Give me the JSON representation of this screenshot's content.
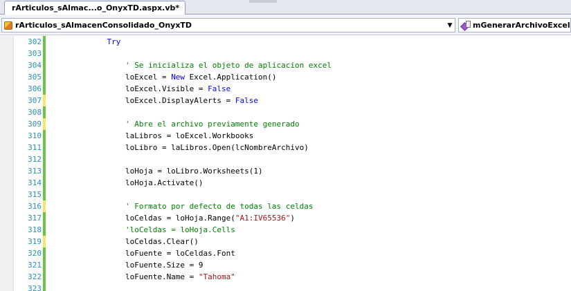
{
  "document_tab": {
    "title": "rArticulos_sAlmac...o_OnyxTD.aspx.vb*"
  },
  "navigation": {
    "class_combo": {
      "value": "rArticulos_sAlmacenConsolidado_OnyxTD",
      "icon": "class-icon"
    },
    "method_combo": {
      "value": "mGenerarArchivoExcel",
      "icon": "method-icon"
    }
  },
  "colors": {
    "keyword": "#0000ff",
    "comment": "#008000",
    "string": "#a31515",
    "line_number": "#2b91af",
    "change_saved": "#6cc34a",
    "change_unsaved": "#f5e86a"
  },
  "code_lines": [
    {
      "number": "302",
      "change": "saved",
      "tokens": [
        {
          "t": "            ",
          "k": ""
        },
        {
          "t": "Try",
          "k": "kw"
        }
      ]
    },
    {
      "number": "303",
      "change": "saved",
      "tokens": []
    },
    {
      "number": "304",
      "change": "saved",
      "tokens": [
        {
          "t": "                ",
          "k": ""
        },
        {
          "t": "' Se inicializa el objeto de aplicacion excel",
          "k": "cm"
        }
      ]
    },
    {
      "number": "305",
      "change": "saved",
      "tokens": [
        {
          "t": "                loExcel = ",
          "k": ""
        },
        {
          "t": "New",
          "k": "kw"
        },
        {
          "t": " Excel.Application()",
          "k": ""
        }
      ]
    },
    {
      "number": "306",
      "change": "saved",
      "tokens": [
        {
          "t": "                loExcel.Visible = ",
          "k": ""
        },
        {
          "t": "False",
          "k": "kw"
        }
      ]
    },
    {
      "number": "307",
      "change": "unsaved",
      "tokens": [
        {
          "t": "                loExcel.DisplayAlerts = ",
          "k": ""
        },
        {
          "t": "False",
          "k": "kw"
        }
      ]
    },
    {
      "number": "308",
      "change": "saved",
      "tokens": []
    },
    {
      "number": "309",
      "change": "unsaved",
      "tokens": [
        {
          "t": "                ",
          "k": ""
        },
        {
          "t": "' Abre el archivo previamente generado",
          "k": "cm"
        }
      ]
    },
    {
      "number": "310",
      "change": "saved",
      "tokens": [
        {
          "t": "                laLibros = loExcel.Workbooks",
          "k": ""
        }
      ]
    },
    {
      "number": "311",
      "change": "saved",
      "tokens": [
        {
          "t": "                loLibro = laLibros.Open(lcNombreArchivo)",
          "k": ""
        }
      ]
    },
    {
      "number": "312",
      "change": "saved",
      "tokens": []
    },
    {
      "number": "313",
      "change": "saved",
      "tokens": [
        {
          "t": "                loHoja = loLibro.Worksheets(1)",
          "k": ""
        }
      ]
    },
    {
      "number": "314",
      "change": "saved",
      "tokens": [
        {
          "t": "                loHoja.Activate()",
          "k": ""
        }
      ]
    },
    {
      "number": "315",
      "change": "saved",
      "tokens": []
    },
    {
      "number": "316",
      "change": "unsaved",
      "tokens": [
        {
          "t": "                ",
          "k": ""
        },
        {
          "t": "' Formato por defecto de todas las celdas",
          "k": "cm"
        }
      ]
    },
    {
      "number": "317",
      "change": "saved",
      "tokens": [
        {
          "t": "                loCeldas = loHoja.Range(",
          "k": ""
        },
        {
          "t": "\"A1:IV65536\"",
          "k": "str"
        },
        {
          "t": ")",
          "k": ""
        }
      ]
    },
    {
      "number": "318",
      "change": "saved",
      "tokens": [
        {
          "t": "                ",
          "k": ""
        },
        {
          "t": "'loCeldas = loHoja.Cells",
          "k": "cm"
        }
      ]
    },
    {
      "number": "319",
      "change": "unsaved",
      "tokens": [
        {
          "t": "                loCeldas.Clear()",
          "k": ""
        }
      ]
    },
    {
      "number": "320",
      "change": "saved",
      "tokens": [
        {
          "t": "                loFuente = loCeldas.Font",
          "k": ""
        }
      ]
    },
    {
      "number": "321",
      "change": "saved",
      "tokens": [
        {
          "t": "                loFuente.Size = 9",
          "k": ""
        }
      ]
    },
    {
      "number": "322",
      "change": "saved",
      "tokens": [
        {
          "t": "                loFuente.Name = ",
          "k": ""
        },
        {
          "t": "\"Tahoma\"",
          "k": "str"
        }
      ]
    },
    {
      "number": "323",
      "change": "saved",
      "tokens": []
    }
  ]
}
